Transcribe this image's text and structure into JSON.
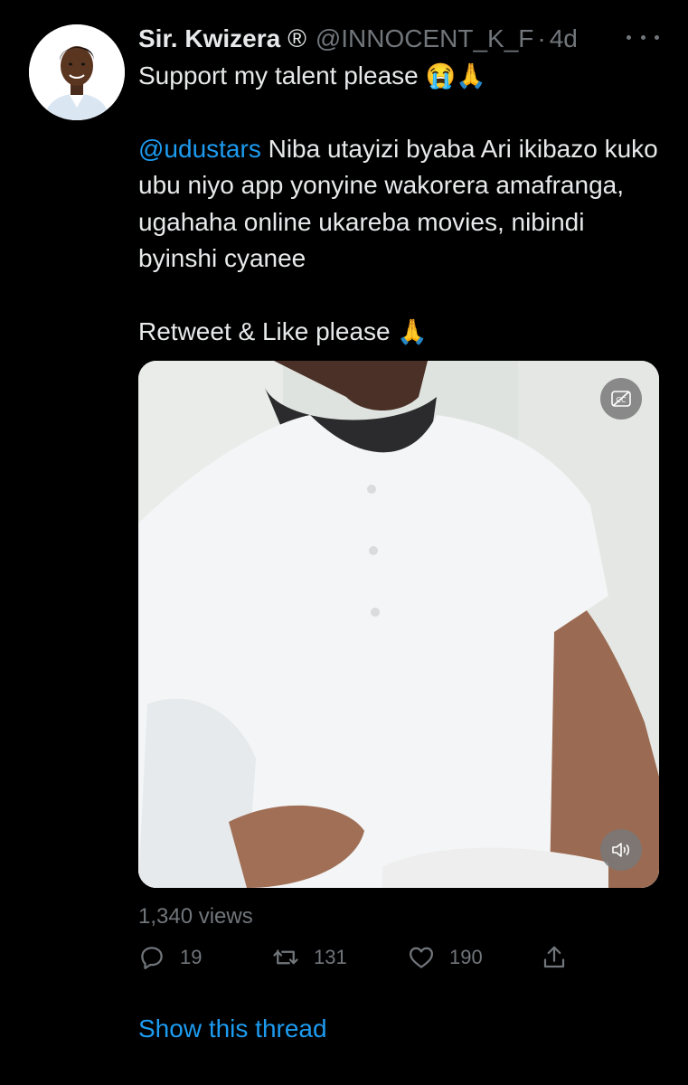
{
  "tweet": {
    "display_name": "Sir. Kwizera",
    "verified_mark": "®",
    "handle": "@INNOCENT_K_F",
    "separator": "·",
    "time": "4d",
    "line1_text": "Support my talent please",
    "line1_emojis": "😭🙏",
    "mention": "@udustars",
    "body_text": " Niba utayizi byaba Ari ikibazo kuko ubu niyo app yonyine wakorera amafranga, ugahaha online ukareba movies, nibindi byinshi cyanee",
    "closing_text": "Retweet & Like please",
    "closing_emoji": "🙏"
  },
  "media": {
    "cc_icon": "closed-captions-off-icon",
    "volume_icon": "volume-muted-icon"
  },
  "stats": {
    "views": "1,340 views",
    "replies": "19",
    "retweets": "131",
    "likes": "190"
  },
  "links": {
    "show_thread": "Show this thread"
  },
  "colors": {
    "background": "#000000",
    "text": "#e7e9ea",
    "muted": "#71767b",
    "accent": "#1d9bf0"
  }
}
